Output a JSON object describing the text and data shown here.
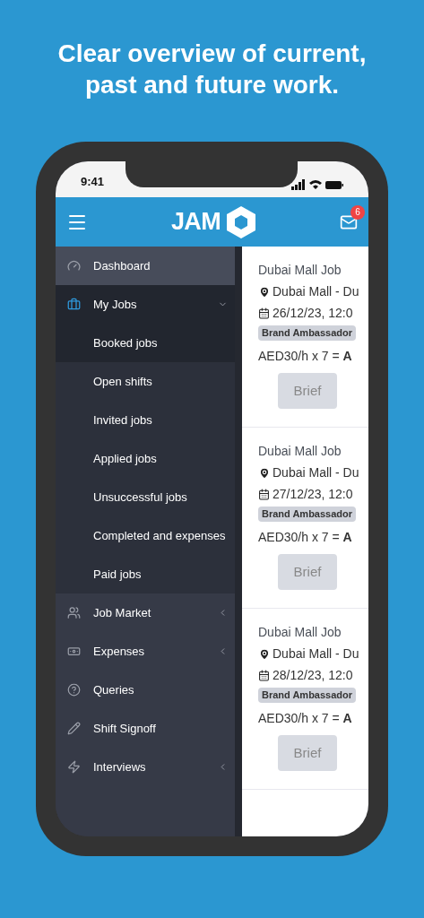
{
  "headline": "Clear overview of current, past and future work.",
  "status_bar": {
    "time": "9:41"
  },
  "header": {
    "logo_text": "JAM",
    "notification_count": "6"
  },
  "sidebar": {
    "items": [
      {
        "label": "Dashboard",
        "kind": "link",
        "selected": false,
        "hovered": true
      },
      {
        "label": "My Jobs",
        "kind": "group",
        "selected": true,
        "hovered": false,
        "expanded": true,
        "children": [
          {
            "label": "Booked jobs",
            "selected": true
          },
          {
            "label": "Open shifts",
            "selected": false
          },
          {
            "label": "Invited jobs",
            "selected": false
          },
          {
            "label": "Applied jobs",
            "selected": false
          },
          {
            "label": "Unsuccessful jobs",
            "selected": false
          },
          {
            "label": "Completed and expenses",
            "selected": false
          },
          {
            "label": "Paid jobs",
            "selected": false
          }
        ]
      },
      {
        "label": "Job Market",
        "kind": "group",
        "selected": false,
        "hovered": false,
        "expanded": false
      },
      {
        "label": "Expenses",
        "kind": "group",
        "selected": false,
        "hovered": false,
        "expanded": false
      },
      {
        "label": "Queries",
        "kind": "link",
        "selected": false,
        "hovered": false
      },
      {
        "label": "Shift Signoff",
        "kind": "link",
        "selected": false,
        "hovered": false
      },
      {
        "label": "Interviews",
        "kind": "group",
        "selected": false,
        "hovered": false,
        "expanded": false
      }
    ]
  },
  "jobs": [
    {
      "title": "Dubai Mall Job",
      "location": "Dubai Mall - Du",
      "date": "26/12/23, 12:0",
      "role": "Brand Ambassador",
      "rate": "AED30/h x 7 = **A**",
      "button": "Brief",
      "disabled": true
    },
    {
      "title": "Dubai Mall Job",
      "location": "Dubai Mall - Du",
      "date": "27/12/23, 12:0",
      "role": "Brand Ambassador",
      "rate": "AED30/h x 7 = **A**",
      "button": "Brief",
      "disabled": true
    },
    {
      "title": "Dubai Mall Job",
      "location": "Dubai Mall - Du",
      "date": "28/12/23, 12:0",
      "role": "Brand Ambassador",
      "rate": "AED30/h x 7 = **A**",
      "button": "Brief",
      "disabled": true
    }
  ]
}
